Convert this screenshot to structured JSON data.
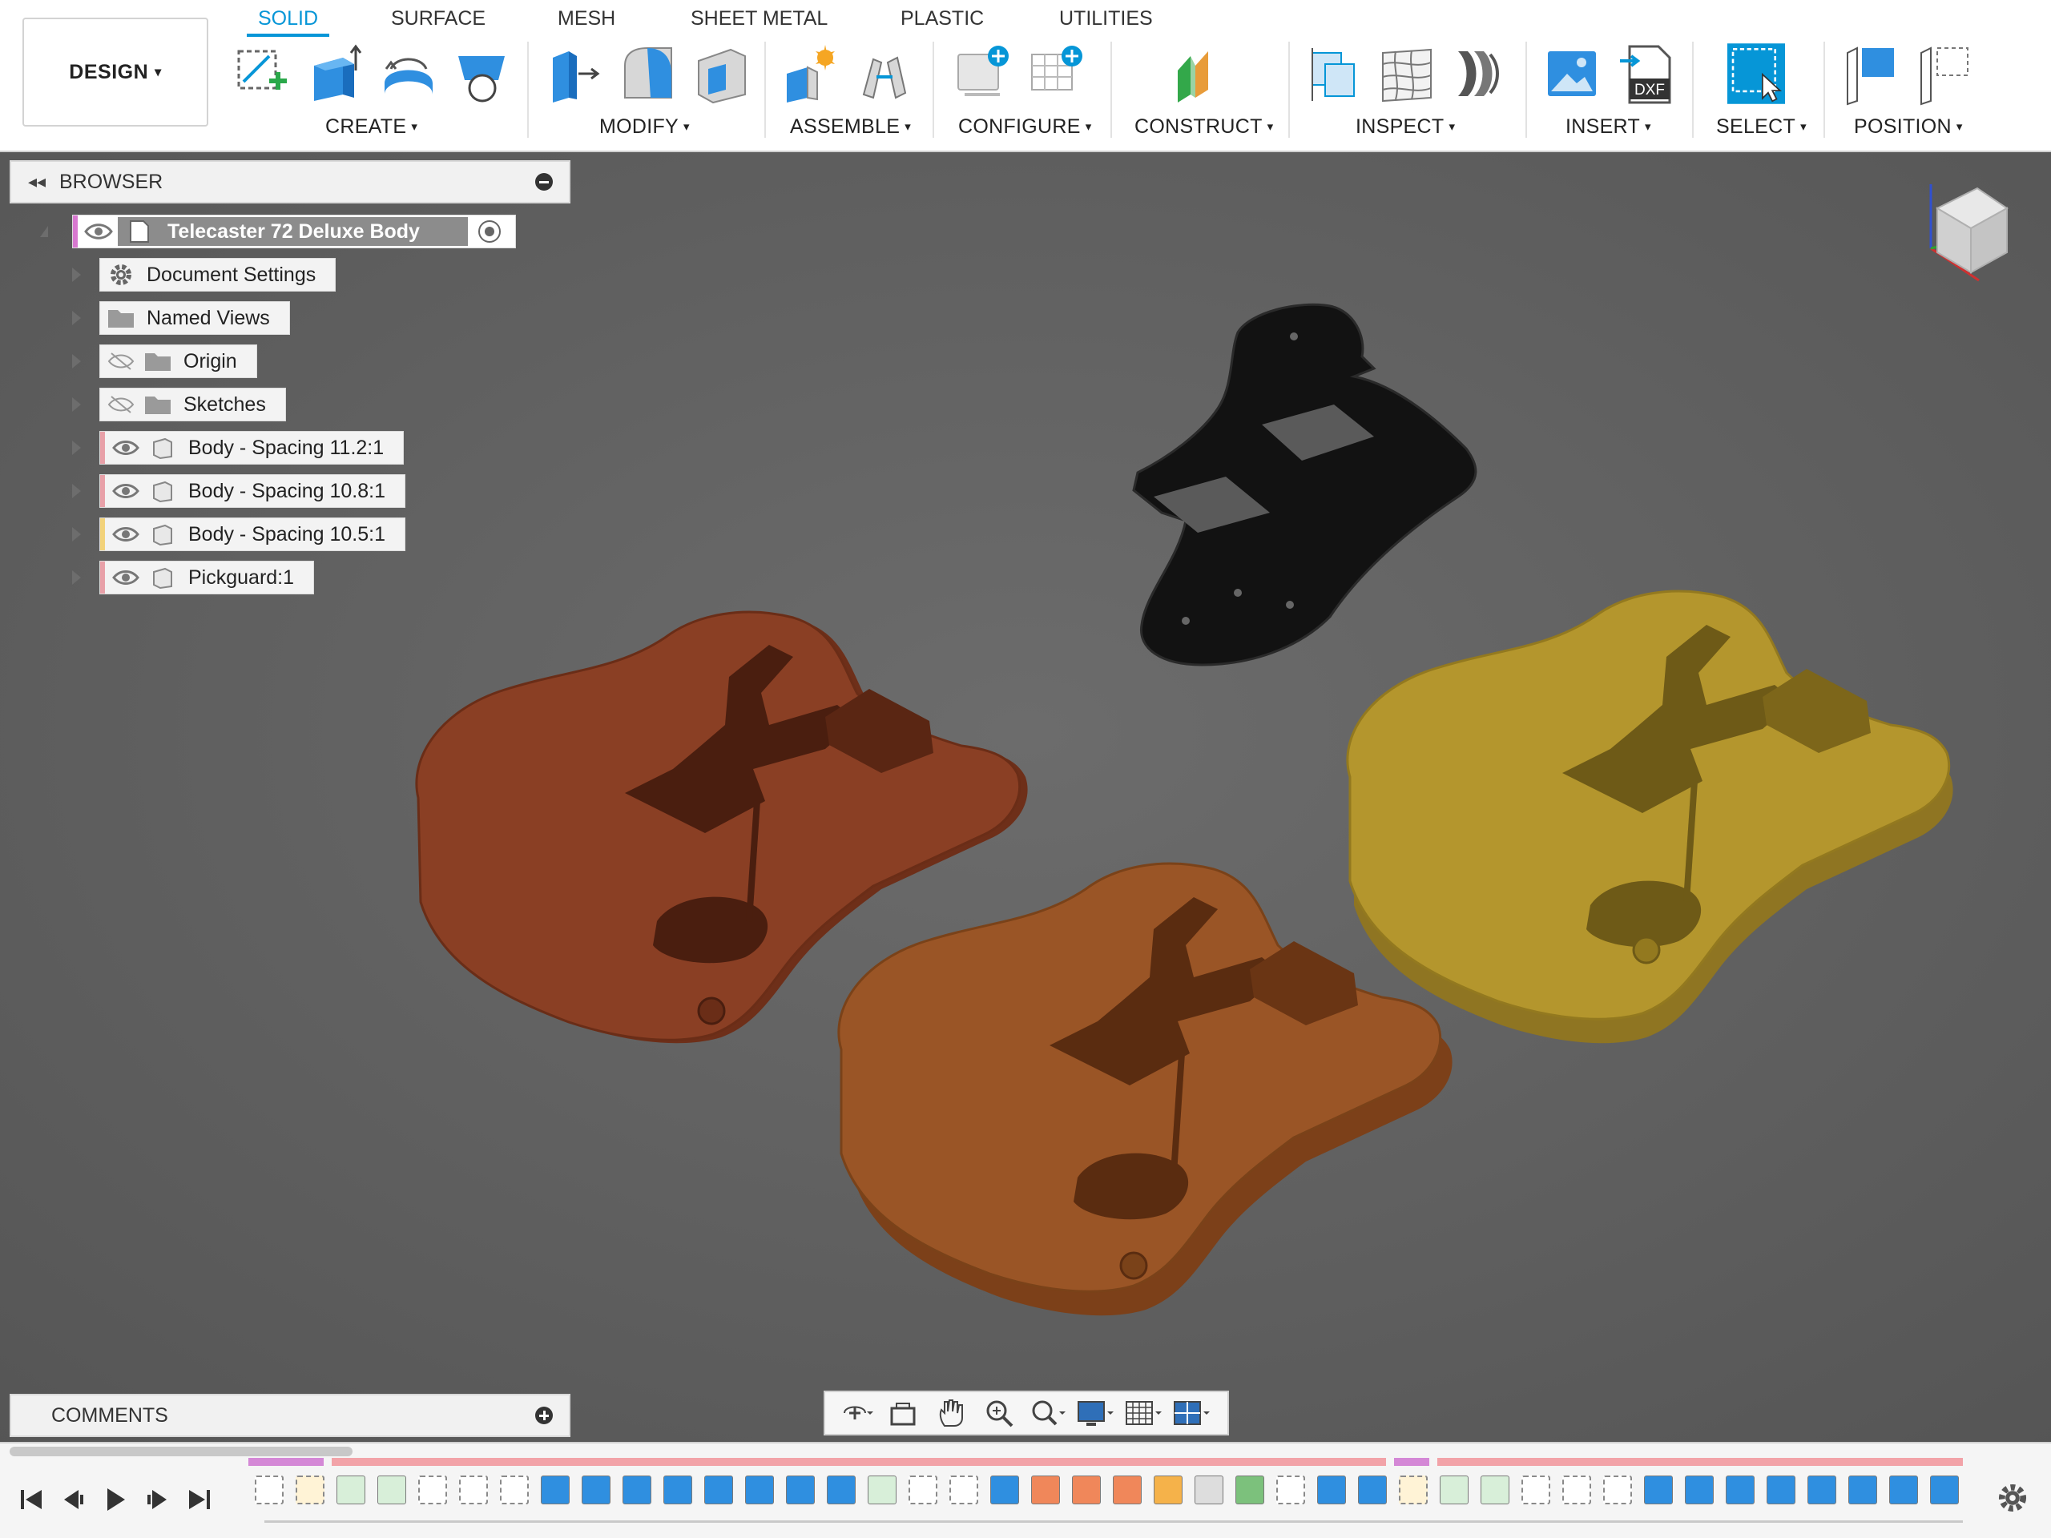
{
  "design_menu": {
    "label": "DESIGN",
    "caret": "▾"
  },
  "tabs": [
    {
      "label": "SOLID",
      "active": true
    },
    {
      "label": "SURFACE",
      "active": false
    },
    {
      "label": "MESH",
      "active": false
    },
    {
      "label": "SHEET METAL",
      "active": false
    },
    {
      "label": "PLASTIC",
      "active": false
    },
    {
      "label": "UTILITIES",
      "active": false
    }
  ],
  "tool_groups": [
    {
      "label": "CREATE",
      "caret": "▾"
    },
    {
      "label": "MODIFY",
      "caret": "▾"
    },
    {
      "label": "ASSEMBLE",
      "caret": "▾"
    },
    {
      "label": "CONFIGURE",
      "caret": "▾"
    },
    {
      "label": "CONSTRUCT",
      "caret": "▾"
    },
    {
      "label": "INSPECT",
      "caret": "▾"
    },
    {
      "label": "INSERT",
      "caret": "▾"
    },
    {
      "label": "SELECT",
      "caret": "▾"
    },
    {
      "label": "POSITION",
      "caret": "▾"
    }
  ],
  "insert_dxf_label": "DXF",
  "browser": {
    "title": "BROWSER",
    "root": {
      "label": "Telecaster 72 Deluxe Body"
    },
    "items": [
      {
        "label": "Document Settings",
        "icon": "gear-icon"
      },
      {
        "label": "Named Views",
        "icon": "folder-icon"
      },
      {
        "label": "Origin",
        "icon": "folder-icon",
        "hidden": true
      },
      {
        "label": "Sketches",
        "icon": "folder-icon",
        "hidden": true
      },
      {
        "label": "Body - Spacing 11.2:1",
        "icon": "component-icon",
        "color": "#e8a0a8"
      },
      {
        "label": "Body - Spacing 10.8:1",
        "icon": "component-icon",
        "color": "#e8a0a8"
      },
      {
        "label": "Body - Spacing 10.5:1",
        "icon": "component-icon",
        "color": "#f2d27a"
      },
      {
        "label": "Pickguard:1",
        "icon": "component-icon",
        "color": "#e8a0a8"
      }
    ]
  },
  "comments": {
    "title": "COMMENTS"
  },
  "colors": {
    "accent": "#0696d7",
    "viewport": "#616161",
    "body_red": "#8a3f24",
    "body_orange": "#9a5526",
    "body_gold": "#b4962d",
    "pickguard": "#121212"
  },
  "navbar_icons": [
    "orbit-icon",
    "look-at-icon",
    "pan-icon",
    "zoom-icon",
    "zoom-window-icon",
    "display-settings-icon",
    "grid-icon",
    "viewports-icon"
  ],
  "timeline_icons": [
    "go-to-start-icon",
    "step-back-icon",
    "play-icon",
    "step-forward-icon",
    "go-to-end-icon",
    "settings-icon"
  ]
}
